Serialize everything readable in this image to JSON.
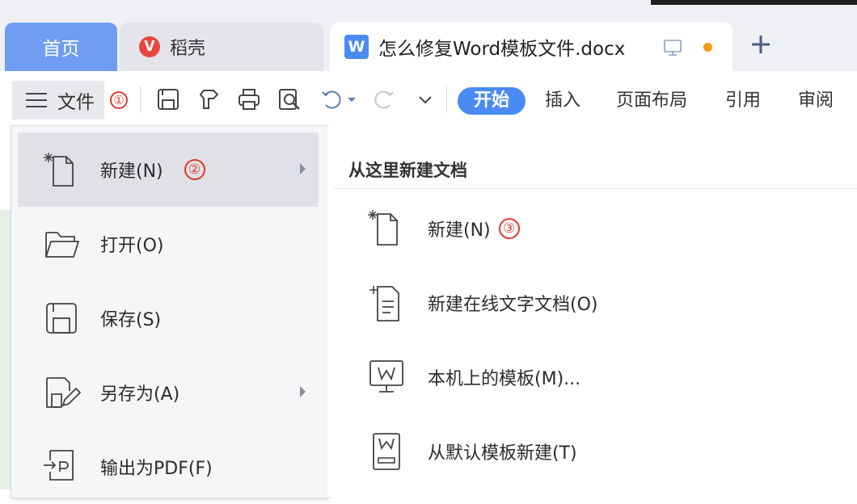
{
  "tabs": {
    "home": "首页",
    "daoke": "稻壳",
    "doc_title": "怎么修复Word模板文件.docx"
  },
  "toolbar": {
    "file_label": "文件",
    "file_badge": "①",
    "ribbon": [
      "开始",
      "插入",
      "页面布局",
      "引用",
      "审阅"
    ],
    "active_ribbon": "开始"
  },
  "menu": {
    "items": [
      {
        "label": "新建(N)",
        "badge": "②",
        "icon": "new-file-icon",
        "has_submenu": true,
        "selected": true
      },
      {
        "label": "打开(O)",
        "icon": "folder-icon",
        "has_submenu": false
      },
      {
        "label": "保存(S)",
        "icon": "save-icon",
        "has_submenu": false
      },
      {
        "label": "另存为(A)",
        "icon": "save-as-icon",
        "has_submenu": true
      },
      {
        "label": "输出为PDF(F)",
        "icon": "export-pdf-icon",
        "has_submenu": false
      }
    ]
  },
  "submenu": {
    "heading": "从这里新建文档",
    "items": [
      {
        "label": "新建(N)",
        "badge": "③",
        "icon": "new-file-icon"
      },
      {
        "label": "新建在线文字文档(O)",
        "icon": "new-online-doc-icon"
      },
      {
        "label": "本机上的模板(M)...",
        "icon": "local-template-icon"
      },
      {
        "label": "从默认模板新建(T)",
        "icon": "default-template-icon"
      }
    ]
  },
  "colors": {
    "accent": "#4a8bf3",
    "home_tab": "#6f9df1",
    "badge_red": "#e03a2e",
    "modified_dot": "#f39c12"
  }
}
